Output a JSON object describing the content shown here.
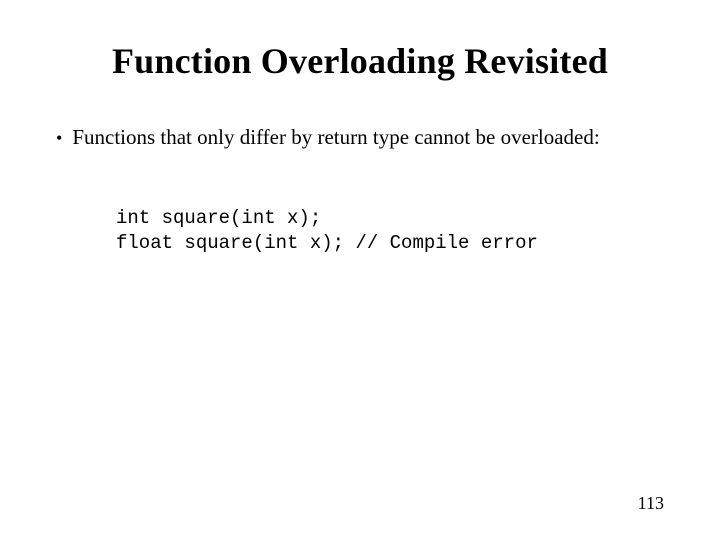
{
  "slide": {
    "title": "Function Overloading Revisited",
    "bullet": "Functions that only differ by return type cannot be overloaded:",
    "code_line1": "int square(int x);",
    "code_line2": "float square(int x); // Compile error",
    "page_number": "113"
  }
}
